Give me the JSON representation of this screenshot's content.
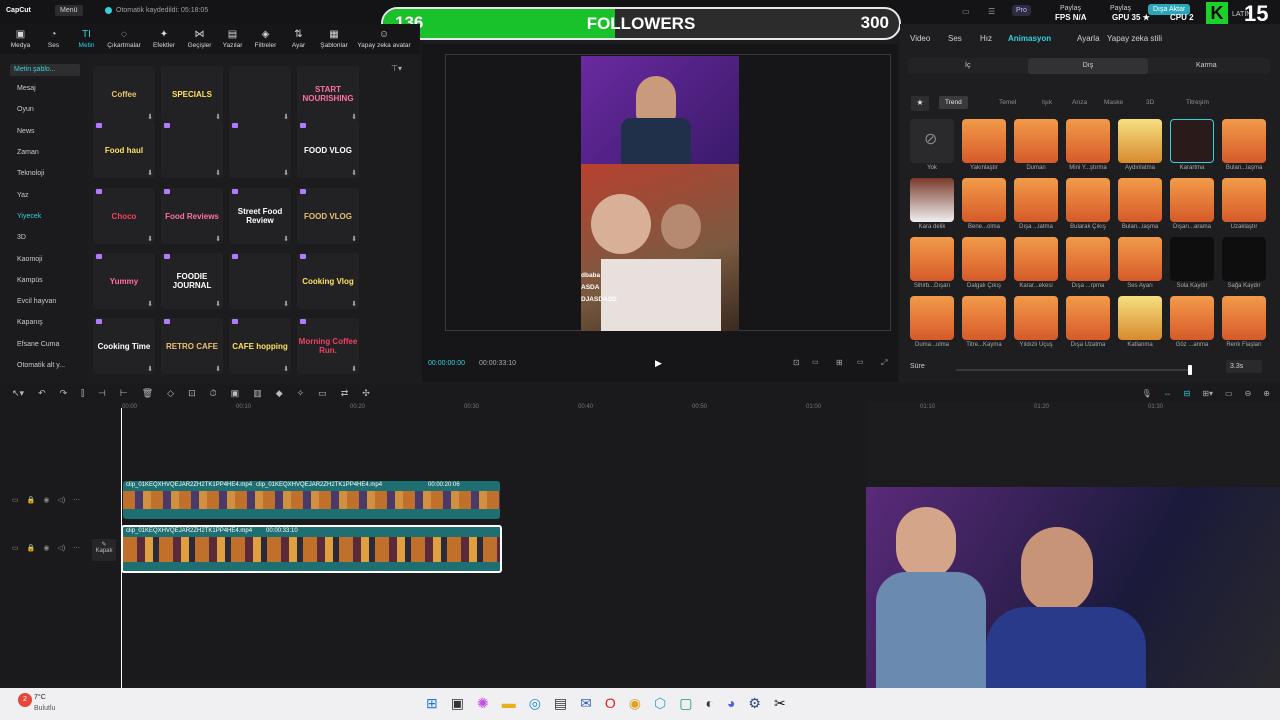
{
  "app": {
    "logo": "CapCut",
    "menu": "Menü",
    "autosave": "Otomatik kaydedildi: 05:18:05"
  },
  "topright": {
    "pro": "Pro",
    "share1": "Paylaş",
    "share2": "Paylaş",
    "export": "Dışa Aktar",
    "fps": "FPS N/A",
    "gpu": "GPU 35 ★",
    "cpu": "CPU 2",
    "lang": "LATIN",
    "brand_logo": "K",
    "channel_num": "15"
  },
  "banner": {
    "left": "136",
    "center": "FOLLOWERS",
    "right": "300",
    "progress": 0.45
  },
  "toolbar": [
    "Medya",
    "Ses",
    "Metin",
    "Çıkartmalar",
    "Efektler",
    "Geçişler",
    "Yazılar",
    "Filtreler",
    "Ayar",
    "Şablonlar",
    "Yapay zeka avatar"
  ],
  "leftnav": {
    "top": "Metin şablo...",
    "items": [
      "Mesaj",
      "Oyun",
      "News",
      "Zaman",
      "Teknoloji",
      "Yaz",
      "Yiyecek",
      "3D",
      "Kaomoji",
      "Kampüs",
      "Evcil hayvan",
      "Kapanış",
      "Efsane Cuma",
      "Otomatik alt y..."
    ]
  },
  "tiles": [
    [
      "Coffee",
      "SPECIALS",
      "",
      "START NOURISHING"
    ],
    [
      "Food haul",
      "",
      "",
      "FOOD VLOG"
    ],
    [
      "Choco",
      "Food Reviews",
      "Street Food Review",
      "FOOD VLOG"
    ],
    [
      "Yummy",
      "FOODIE JOURNAL",
      "",
      "Cooking Vlog"
    ],
    [
      "Cooking Time",
      "RETRO CAFE",
      "CAFE hopping",
      "Morning Coffee Run."
    ]
  ],
  "preview": {
    "time_current": "00:00:00:00",
    "time_total": "00:00:33:10",
    "overlay_lines": [
      "dbaba",
      "ASDA",
      "DJASDASD"
    ]
  },
  "right_panel": {
    "tabs": [
      "Video",
      "Ses",
      "Hız",
      "Animasyon",
      "Ayarla",
      "Yapay zeka stili"
    ],
    "subtabs": [
      "İç",
      "Dış",
      "Karma"
    ],
    "chips": [
      "Trend",
      "Temel",
      "Işık",
      "Arıza",
      "Maske",
      "3D",
      "Titreşim"
    ],
    "effects": [
      "Yok",
      "Yakınlaştır",
      "Duman",
      "Mini Y...ştırma",
      "Aydınlatma",
      "Karartma",
      "Bulan...laşma",
      "Kara delik",
      "Bene...olma",
      "Dışa ...latma",
      "Bularak Çıkış",
      "Bulan...laşma",
      "Dışarı...arama",
      "Uzaklaştır",
      "Sihirb...Dışarı",
      "Dalgalı Çıkış",
      "Karar...ekesi",
      "Dışa ...rpma",
      "Ses Ayarı",
      "Sola Kaydır",
      "Sağa Kaydır",
      "Duma...ulma",
      "Titre...Kayma",
      "Yıldızlı Uçuş",
      "Dışa Uzatma",
      "Katlanma",
      "Göz ...anma",
      "Renk Flaşları"
    ],
    "duration_label": "Süre",
    "duration_value": "3.3s"
  },
  "timeline": {
    "ruler": [
      "00:00",
      "00:10",
      "00:20",
      "00:30",
      "00:40",
      "00:50",
      "01:00",
      "01:10",
      "01:20",
      "01:30"
    ],
    "clip1": "clip_01KEQXHVQEJAR2ZH2TK1PP4HE4.mp4",
    "clip1b": "clip_01KEQXHVQEJAR2ZH2TK1PP4HE4.mp4",
    "clip1_dur": "00:00:20:06",
    "clip2": "clip_01KEQXHVQEJAR2ZH2TK1PP4HE4.mp4",
    "clip2_dur": "00:00:33:10",
    "cover": "Kapak"
  },
  "weather": {
    "temp": "7°C",
    "desc": "Bulutlu",
    "badge": "2"
  },
  "colors": {
    "accent": "#35d0e0",
    "banner_fill": "#19c22a"
  }
}
